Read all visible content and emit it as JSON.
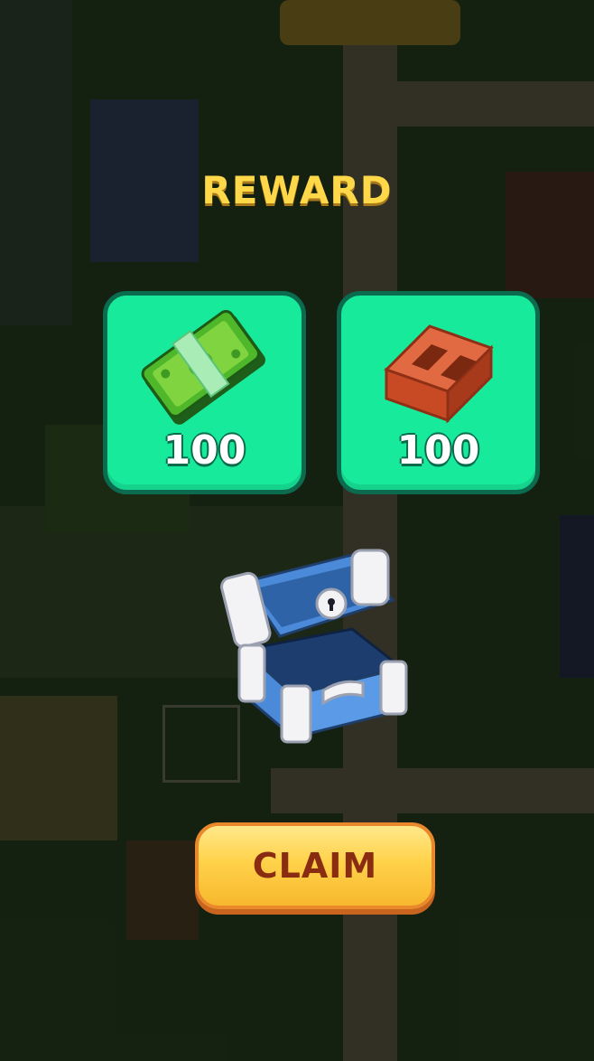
{
  "title": "REWARD",
  "rewards": [
    {
      "item": "cash",
      "icon": "cash-stack-icon",
      "amount": "100"
    },
    {
      "item": "brick",
      "icon": "brick-icon",
      "amount": "100"
    }
  ],
  "chest": {
    "icon": "treasure-chest-icon"
  },
  "claim_label": "CLAIM",
  "colors": {
    "title": "#ffd84a",
    "card_bg": "#18ea9c",
    "card_border": "#0b6b4f",
    "button": "#ffd24a",
    "button_text": "#8a2c12"
  }
}
